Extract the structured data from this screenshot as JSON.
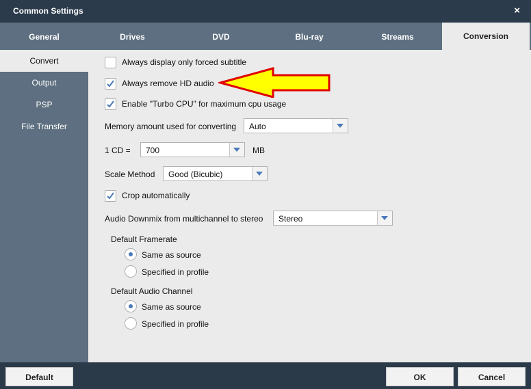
{
  "window": {
    "title": "Common Settings",
    "close_icon": "×"
  },
  "tabs": [
    {
      "label": "General"
    },
    {
      "label": "Drives"
    },
    {
      "label": "DVD"
    },
    {
      "label": "Blu-ray"
    },
    {
      "label": "Streams"
    },
    {
      "label": "Conversion",
      "active": true
    }
  ],
  "sidebar": {
    "items": [
      {
        "label": "Convert",
        "active": true
      },
      {
        "label": "Output"
      },
      {
        "label": "PSP"
      },
      {
        "label": "File Transfer"
      }
    ]
  },
  "conversion": {
    "forced_subtitle": {
      "label": "Always display only forced subtitle",
      "checked": false
    },
    "remove_hd_audio": {
      "label": "Always remove HD audio",
      "checked": true
    },
    "turbo_cpu": {
      "label": "Enable \"Turbo CPU\" for maximum cpu usage",
      "checked": true
    },
    "memory": {
      "label": "Memory amount used for converting",
      "value": "Auto"
    },
    "cd_size": {
      "label": "1 CD =",
      "value": "700",
      "unit": "MB"
    },
    "scale_method": {
      "label": "Scale Method",
      "value": "Good (Bicubic)"
    },
    "crop": {
      "label": "Crop automatically",
      "checked": true
    },
    "downmix": {
      "label": "Audio Downmix from multichannel to stereo",
      "value": "Stereo"
    },
    "framerate": {
      "heading": "Default Framerate",
      "options": [
        {
          "label": "Same as source",
          "selected": true
        },
        {
          "label": "Specified in profile",
          "selected": false
        }
      ]
    },
    "audio_channel": {
      "heading": "Default Audio Channel",
      "options": [
        {
          "label": "Same as source",
          "selected": true
        },
        {
          "label": "Specified in profile",
          "selected": false
        }
      ]
    }
  },
  "annotation": {
    "arrow_color": "#ffff00",
    "arrow_outline": "#e00000"
  },
  "footer": {
    "default_label": "Default",
    "ok_label": "OK",
    "cancel_label": "Cancel"
  }
}
